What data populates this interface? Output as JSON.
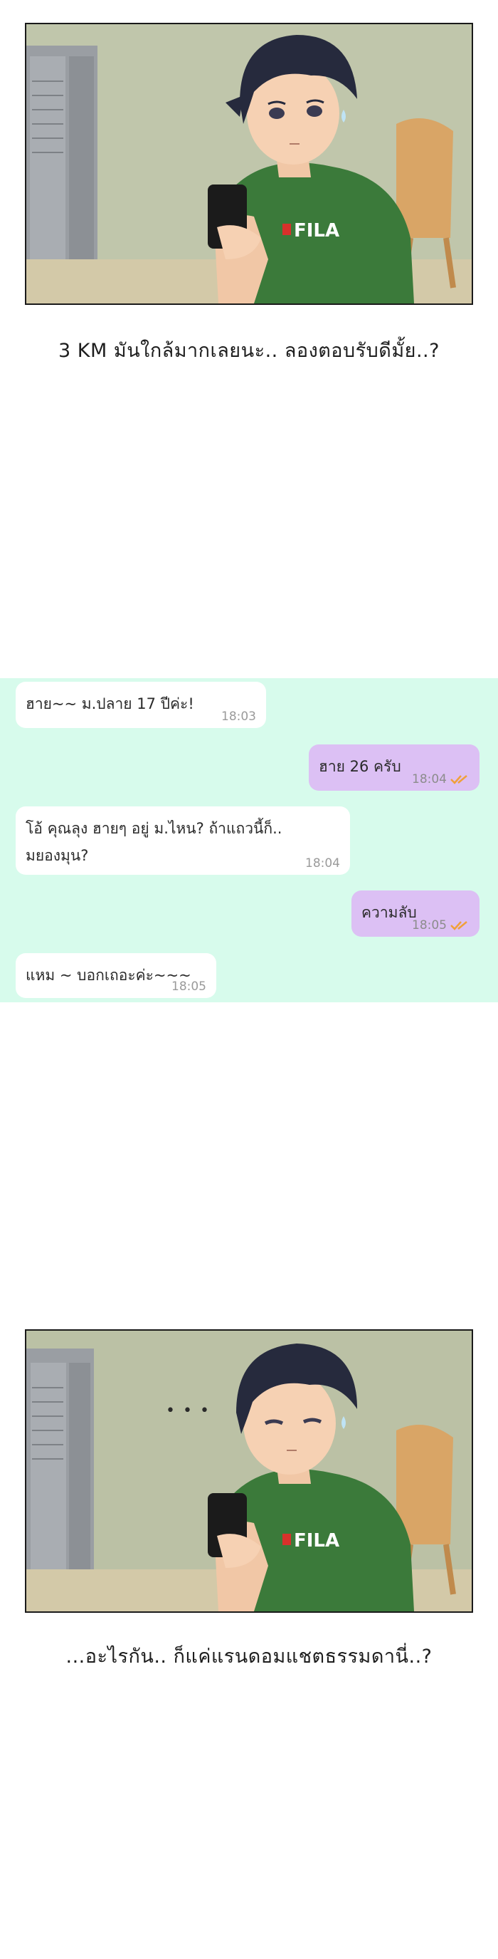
{
  "panels": [
    {
      "caption": "3 KM มันใกล้มากเลยนะ.. ลองตอบรับดีมั้ย..?"
    },
    {
      "caption": "...อะไรกัน.. ก็แค่แรนดอมแชตธรรมดานี่..?",
      "thought": "• • •"
    }
  ],
  "chat": {
    "messages": [
      {
        "direction": "incoming",
        "text": "ฮาย~~ ม.ปลาย 17 ปีค่ะ!",
        "time": "18:03"
      },
      {
        "direction": "outgoing",
        "text": "ฮาย 26 ครับ",
        "time": "18:04",
        "status": "read"
      },
      {
        "direction": "incoming",
        "text": "โอ้ คุณลุง ฮายๆ อยู่ ม.ไหน? ถ้าแถวนี้ก็..\nมยองมุน?",
        "time": "18:04"
      },
      {
        "direction": "outgoing",
        "text": "ความลับ",
        "time": "18:05",
        "status": "read"
      },
      {
        "direction": "incoming",
        "text": "แหม ~ บอกเถอะค่ะ~~~",
        "time": "18:05"
      }
    ]
  },
  "colors": {
    "chat_background": "#d7fbec",
    "incoming_bubble": "#ffffff",
    "outgoing_bubble": "#dcc0f4",
    "read_ticks": "#f0a03a",
    "shirt": "#3b7a3a"
  }
}
